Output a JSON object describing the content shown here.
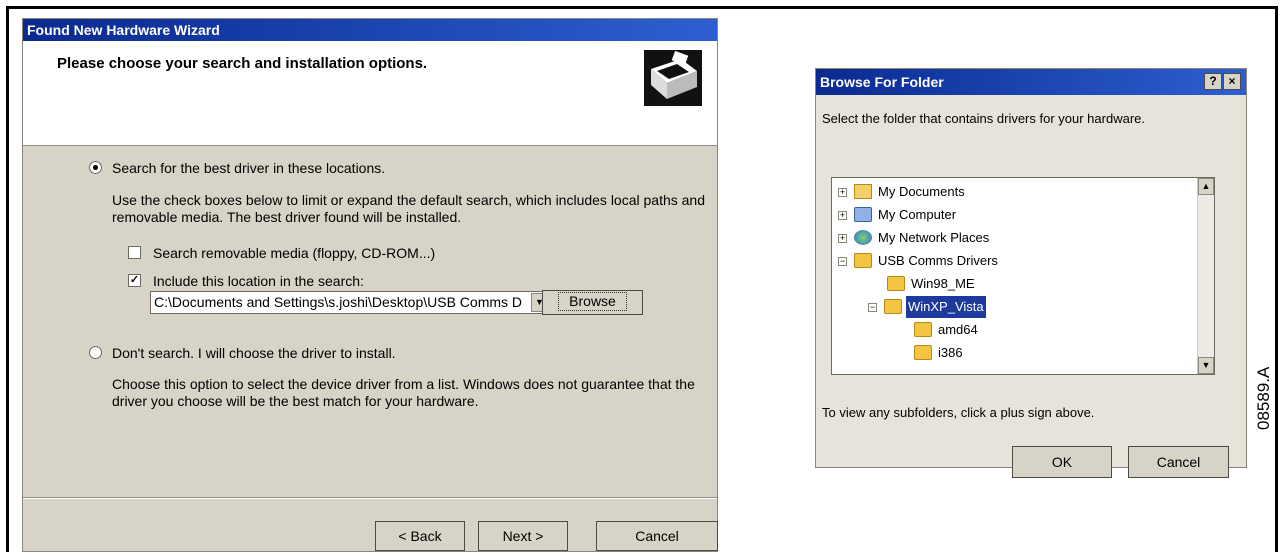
{
  "wizard": {
    "title": "Found New Hardware Wizard",
    "heading": "Please choose your search and installation options.",
    "option_search": "Search for the best driver in these locations.",
    "search_description": "Use the check boxes below to limit or expand the default search, which includes local paths and removable media. The best driver found will be installed.",
    "check_removable": "Search removable media (floppy, CD-ROM...)",
    "check_location": "Include this location in the search:",
    "location_value": "C:\\Documents and Settings\\s.joshi\\Desktop\\USB Comms Drivers\\WinXP_Vista",
    "browse_label": "Browse",
    "option_dont_search": "Don't search. I will choose the driver to install.",
    "dont_search_description": "Choose this option to select the device driver from a list.  Windows does not guarantee that the driver you choose will be the best match for your hardware.",
    "back_label": "< Back",
    "next_label": "Next >",
    "cancel_label": "Cancel",
    "selected_option": "search",
    "removable_checked": false,
    "location_checked": true
  },
  "browse_dialog": {
    "title": "Browse For Folder",
    "help_button": "?",
    "close_button": "×",
    "prompt": "Select the folder that contains drivers for your hardware.",
    "tree": [
      {
        "label": "My Documents",
        "icon": "my-documents-icon",
        "expander": "+"
      },
      {
        "label": "My Computer",
        "icon": "my-computer-icon",
        "expander": "+"
      },
      {
        "label": "My Network Places",
        "icon": "network-places-icon",
        "expander": "+"
      },
      {
        "label": "USB Comms Drivers",
        "icon": "folder-icon",
        "expander": "−"
      },
      {
        "label": "Win98_ME",
        "icon": "folder-icon",
        "expander": ""
      },
      {
        "label": "WinXP_Vista",
        "icon": "folder-open-icon",
        "expander": "−",
        "selected": true
      },
      {
        "label": "amd64",
        "icon": "folder-icon",
        "expander": ""
      },
      {
        "label": "i386",
        "icon": "folder-icon",
        "expander": ""
      }
    ],
    "hint": "To view any subfolders, click a plus sign above.",
    "ok_label": "OK",
    "cancel_label": "Cancel"
  },
  "figure_label": "08589.A",
  "colors": {
    "titlebar": "#0a2a8f",
    "dialog_bg": "#d8d3c7",
    "selection": "#1d3a9c"
  }
}
